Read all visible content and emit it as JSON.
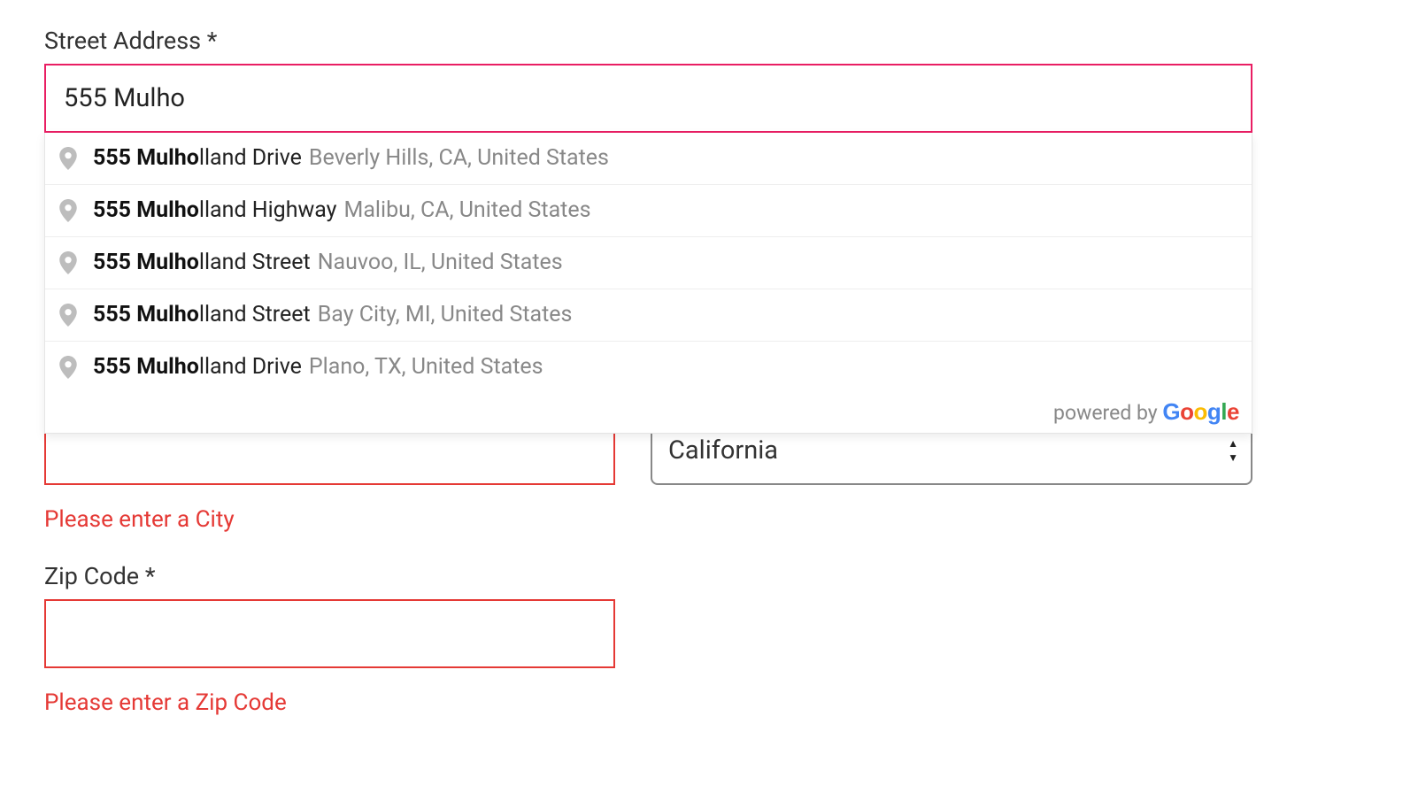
{
  "labels": {
    "street": "Street Address *",
    "zip": "Zip Code *",
    "powered_by": "powered by "
  },
  "street": {
    "value": "555 Mulho"
  },
  "suggestions": [
    {
      "bold": "555 Mulho",
      "rest": "lland Drive",
      "secondary": "Beverly Hills, CA, United States"
    },
    {
      "bold": "555 Mulho",
      "rest": "lland Highway",
      "secondary": "Malibu, CA, United States"
    },
    {
      "bold": "555 Mulho",
      "rest": "lland Street",
      "secondary": "Nauvoo, IL, United States"
    },
    {
      "bold": "555 Mulho",
      "rest": "lland Street",
      "secondary": "Bay City, MI, United States"
    },
    {
      "bold": "555 Mulho",
      "rest": "lland Drive",
      "secondary": "Plano, TX, United States"
    }
  ],
  "city": {
    "value": "",
    "error": "Please enter a City"
  },
  "state": {
    "value": "California"
  },
  "zip": {
    "value": "",
    "error": "Please enter a Zip Code"
  },
  "google": {
    "g1": "G",
    "o1": "o",
    "o2": "o",
    "g2": "g",
    "l": "l",
    "e": "e"
  }
}
